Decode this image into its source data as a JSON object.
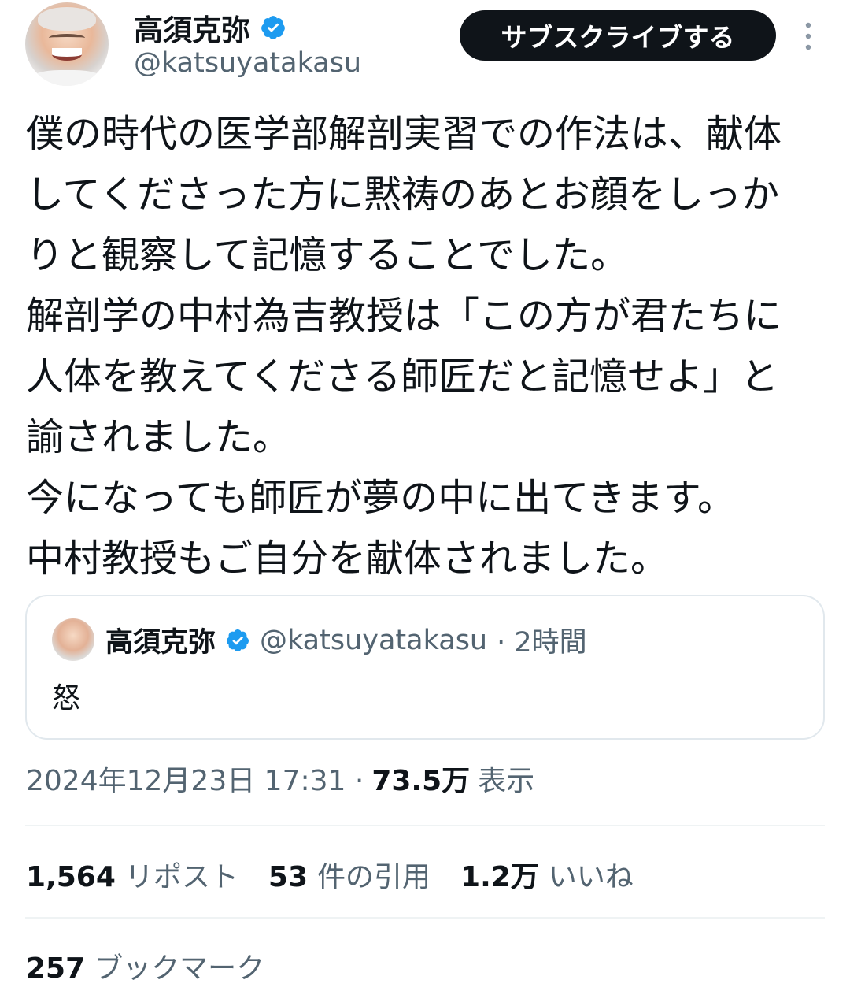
{
  "author": {
    "display_name": "高須克弥",
    "handle": "@katsuyatakasu",
    "verified_icon": "verified-badge-icon",
    "badge_color": "#1d9bf0"
  },
  "header": {
    "subscribe_label": "サブスクライブする",
    "more_icon": "more-vertical-icon"
  },
  "tweet": {
    "lines": [
      "僕の時代の医学部解剖実習での作法は、献体",
      "してくださった方に黙祷のあとお顔をしっか",
      "りと観察して記憶することでした。",
      "解剖学の中村為吉教授は「この方が君たちに",
      "人体を教えてくださる師匠だと記憶せよ」と",
      "諭されました。",
      "今になっても師匠が夢の中に出てきます。",
      "中村教授もご自分を献体されました。"
    ]
  },
  "quote": {
    "display_name": "高須克弥",
    "handle": "@katsuyatakasu",
    "time": "· 2時間",
    "text": "怒"
  },
  "meta": {
    "timestamp": "2024年12月23日 17:31 ·",
    "views_count": "73.5万",
    "views_label": "表示"
  },
  "stats": {
    "reposts_count": "1,564",
    "reposts_label": "リポスト",
    "quotes_count": "53",
    "quotes_label": "件の引用",
    "likes_count": "1.2万",
    "likes_label": "いいね",
    "bookmarks_count": "257",
    "bookmarks_label": "ブックマーク"
  },
  "colors": {
    "text": "#0f1419",
    "muted": "#536471",
    "border": "#e1e8ed",
    "button_bg": "#0f1419"
  }
}
